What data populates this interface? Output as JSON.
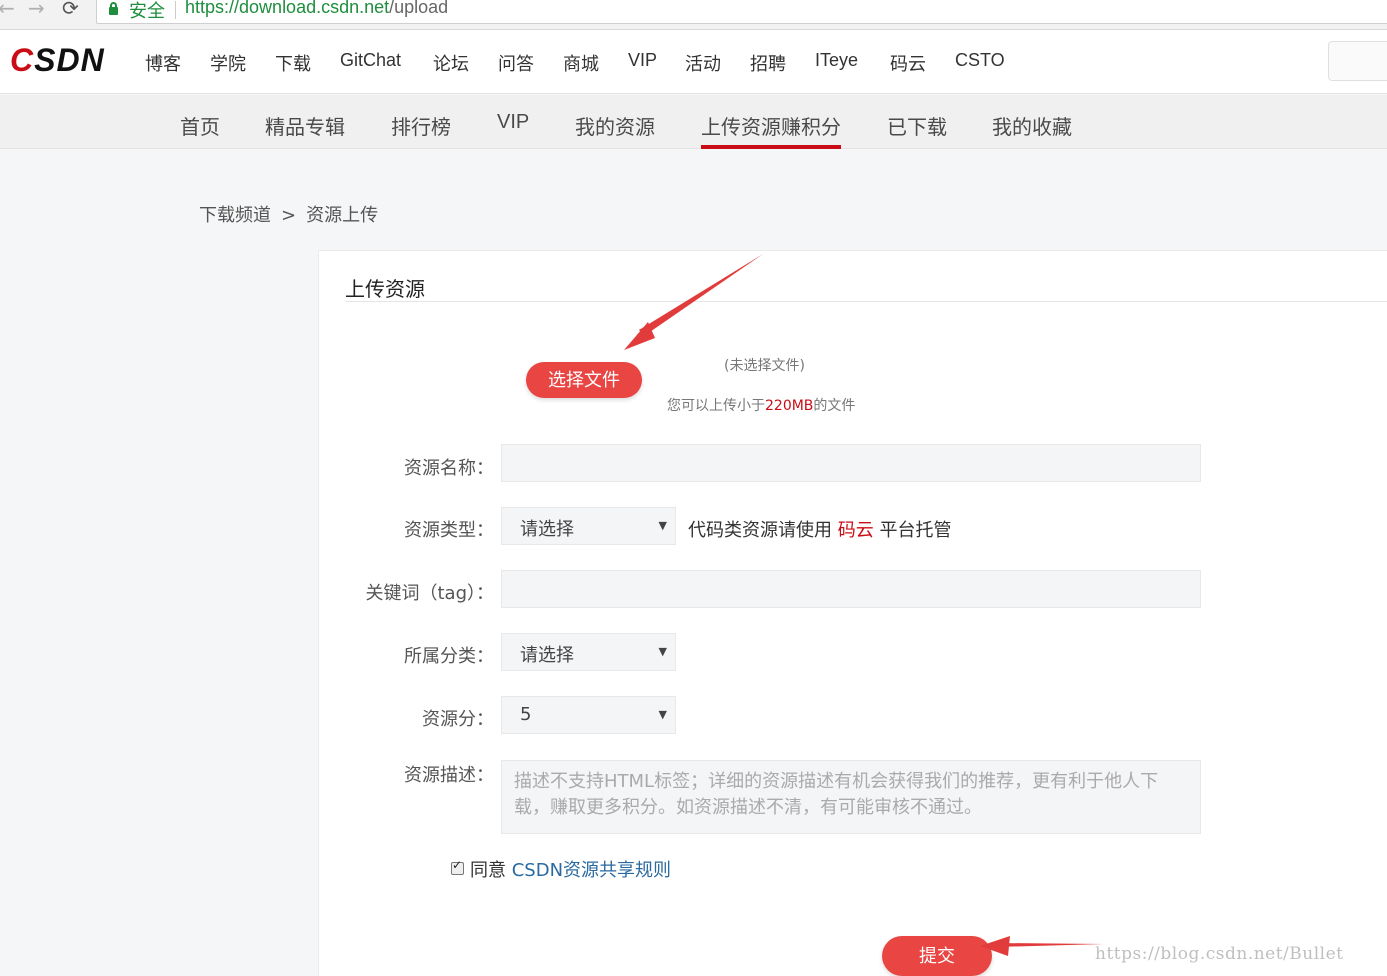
{
  "browser": {
    "back_icon": "arrow-left-icon",
    "forward_icon": "arrow-right-icon",
    "reload_icon": "reload-icon",
    "secure_label": "安全",
    "url_prefix": "https://",
    "url_host": "download.csdn.net",
    "url_path": "/upload"
  },
  "topnav": {
    "logo_c": "C",
    "logo_rest": "SDN",
    "items": [
      "博客",
      "学院",
      "下载",
      "GitChat",
      "论坛",
      "问答",
      "商城",
      "VIP",
      "活动",
      "招聘",
      "ITeye",
      "码云",
      "CSTO"
    ]
  },
  "subnav": {
    "items": [
      "首页",
      "精品专辑",
      "排行榜",
      "VIP",
      "我的资源",
      "上传资源赚积分",
      "已下载",
      "我的收藏"
    ],
    "active_index": 5
  },
  "breadcrumb": {
    "root": "下载频道",
    "separator": ">",
    "current": "资源上传"
  },
  "upload": {
    "title": "上传资源",
    "choose_file_label": "选择文件",
    "no_file_text": "(未选择文件)",
    "hint_prefix": "您可以上传小于",
    "hint_size": "220MB",
    "hint_suffix": "的文件"
  },
  "form": {
    "name_label": "资源名称：",
    "name_value": "",
    "type_label": "资源类型：",
    "type_value": "请选择",
    "type_hint_prefix": "代码类资源请使用",
    "type_hint_link": "码云",
    "type_hint_suffix": "平台托管",
    "tag_label": "关键词（tag）：",
    "tag_value": "",
    "category_label": "所属分类：",
    "category_value": "请选择",
    "score_label": "资源分：",
    "score_value": "5",
    "desc_label": "资源描述：",
    "desc_placeholder": "描述不支持HTML标签；详细的资源描述有机会获得我们的推荐，更有利于他人下载，赚取更多积分。如资源描述不清，有可能审核不通过。",
    "agree_checked": true,
    "agree_prefix": "同意",
    "agree_link": "CSDN资源共享规则",
    "submit_label": "提交"
  },
  "watermark": "https://blog.csdn.net/Bullet",
  "colors": {
    "brand_red": "#ca0c16",
    "button_red": "#e84543",
    "link_blue": "#2a6aa0",
    "secure_green": "#1e8e3e"
  }
}
